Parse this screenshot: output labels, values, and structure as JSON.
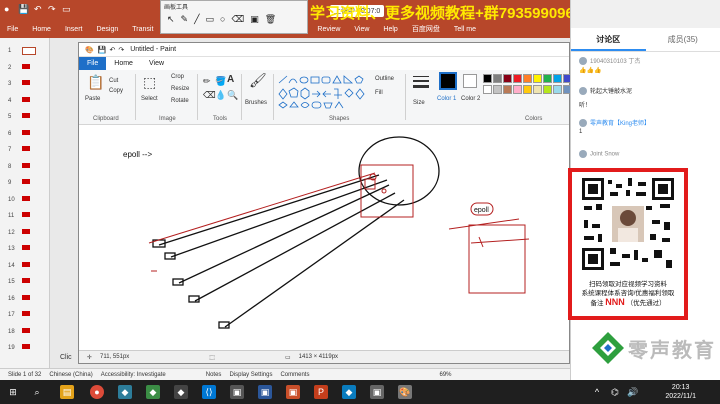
{
  "ppt": {
    "tabs": [
      "File",
      "Home",
      "Insert",
      "Design",
      "Transit",
      "Review",
      "View",
      "Help",
      "百度网盘",
      "Tell me"
    ],
    "recording": "上课中 00:07:0",
    "promo_title": "学习资料、更多视频教程+群793599096",
    "slide_numbers": [
      "1",
      "2",
      "3",
      "4",
      "5",
      "6",
      "7",
      "8",
      "9",
      "10",
      "11",
      "12",
      "13",
      "14",
      "15",
      "16",
      "17",
      "18",
      "19"
    ],
    "status": {
      "slide": "Slide 1 of 32",
      "language": "Chinese (China)",
      "accessibility": "Accessibility: Investigate",
      "notes": "Notes",
      "display": "Display Settings",
      "comments": "Comments",
      "zoom": "69%"
    },
    "click_hint": "Clic"
  },
  "draw_tools": {
    "title": "画板工具"
  },
  "paint": {
    "title": "Untitled - Paint",
    "tabs": [
      "File",
      "Home",
      "View"
    ],
    "clipboard": {
      "paste": "Paste",
      "cut": "Cut",
      "copy": "Copy",
      "label": "Clipboard"
    },
    "image": {
      "select": "Select",
      "crop": "Crop",
      "resize": "Resize",
      "rotate": "Rotate",
      "label": "Image"
    },
    "tools": {
      "label": "Tools"
    },
    "brushes": "Brushes",
    "shapes": {
      "outline": "Outline",
      "fill": "Fill",
      "label": "Shapes"
    },
    "size": "Size",
    "color1": "Color 1",
    "color2": "Color 2",
    "colors_label": "Colors",
    "canvas": {
      "label_epoll_left": "epoll -->",
      "label_epoll_right": "epoll"
    },
    "status": {
      "cursor": "711, 551px",
      "size": "1413 × 4119px"
    }
  },
  "chat": {
    "tabs": [
      "讨论区",
      "成员(35)"
    ],
    "messages": [
      {
        "user": "19040310103 丁杰",
        "text": "👍👍👍"
      },
      {
        "user": "",
        "text": "轮起大锤敲水泥"
      },
      {
        "user": "",
        "text": "听！"
      },
      {
        "user": "零声教育【King老师】",
        "text": "1"
      },
      {
        "user": "Joint Snow",
        "text": ""
      }
    ],
    "qr_caption_1": "扫码领取对应视频学习资料",
    "qr_caption_2": "系统课程体系咨询/优惠福利领取",
    "qr_caption_3": "备注",
    "qr_nnn": "NNN",
    "qr_caption_4": "（优先通过）",
    "brand": "零声教育"
  },
  "taskbar": {
    "time": "20:13",
    "date": "2022/11/1"
  },
  "colors": {
    "ppt_red": "#b7472a",
    "paint_blue": "#1e6fc8",
    "qr_border": "#e21b1b"
  }
}
